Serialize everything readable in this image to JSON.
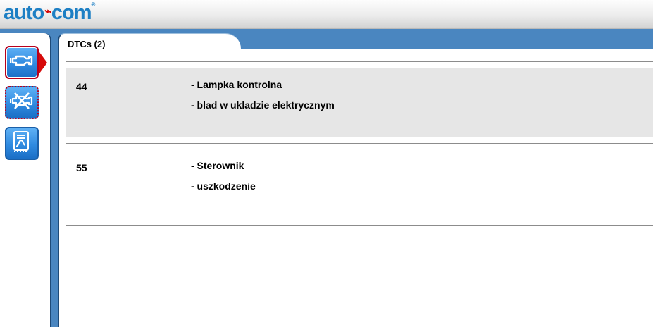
{
  "app": {
    "logo_text_left": "auto",
    "logo_text_right": "com",
    "logo_mark": "registered"
  },
  "sidebar": {
    "items": [
      {
        "name": "engine-diagnostics",
        "icon": "engine-icon",
        "state": "active"
      },
      {
        "name": "engine-disabled",
        "icon": "engine-crossed-icon",
        "state": "dotted"
      },
      {
        "name": "live-data-graph",
        "icon": "data-graph-icon",
        "state": "normal"
      }
    ]
  },
  "tabs": [
    {
      "label": "DTCs (2)"
    }
  ],
  "dtcs": [
    {
      "code": "44",
      "lines": [
        "- Lampka kontrolna",
        "- blad w ukladzie elektrycznym"
      ]
    },
    {
      "code": "55",
      "lines": [
        "- Sterownik",
        "- uszkodzenie"
      ]
    }
  ],
  "colors": {
    "brand_blue": "#1d7fc4",
    "brand_red": "#d40000",
    "frame_blue": "#4a86c0",
    "active_red": "#d60a0a",
    "row_shade": "#e6e6e6"
  }
}
